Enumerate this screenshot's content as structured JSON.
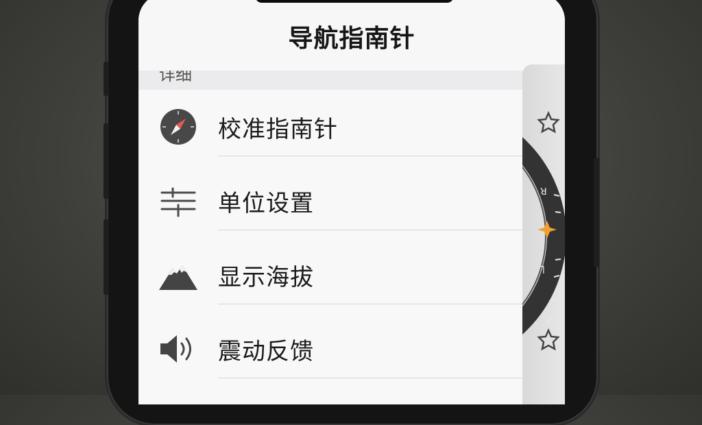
{
  "header": {
    "title": "导航指南针"
  },
  "partial_section_label": "详细",
  "menu": {
    "items": [
      {
        "label": "校准指南针",
        "icon": "compass-icon"
      },
      {
        "label": "单位设置",
        "icon": "sliders-icon"
      },
      {
        "label": "显示海拔",
        "icon": "mountain-icon"
      },
      {
        "label": "震动反馈",
        "icon": "speaker-icon"
      }
    ]
  },
  "compass_preview": {
    "marker_color": "#f0a030",
    "ring_color": "#3a3a3a"
  }
}
